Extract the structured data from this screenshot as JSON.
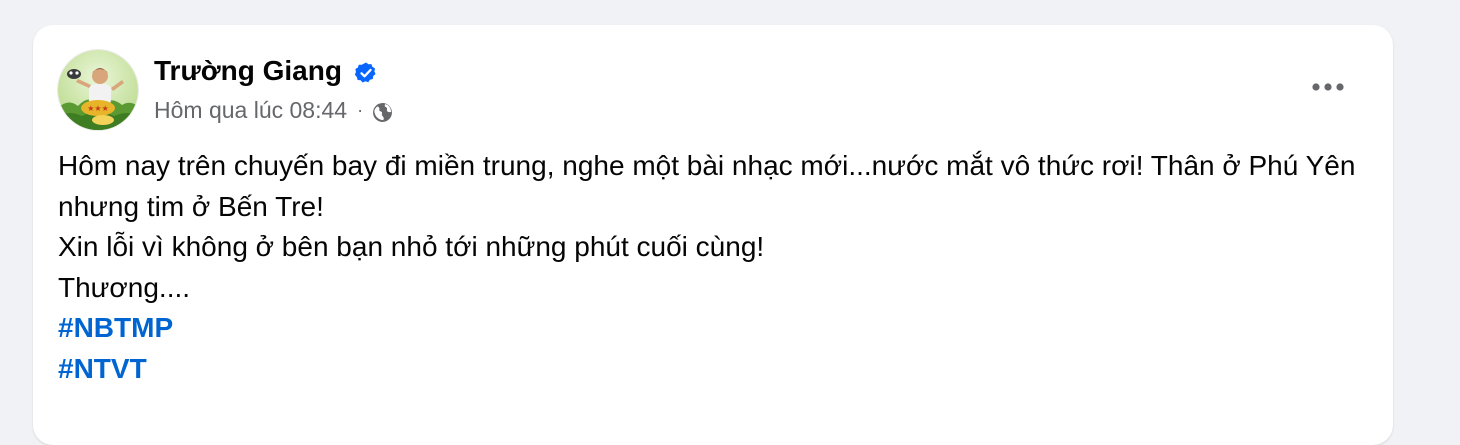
{
  "post": {
    "author": "Trường Giang",
    "timestamp": "Hôm qua lúc 08:44",
    "separator": "·",
    "verified_icon": "verified-badge-icon",
    "privacy_icon": "globe-icon",
    "more_icon": "more-options-icon",
    "text_lines": [
      "Hôm nay trên chuyến bay đi miền trung, nghe một bài nhạc mới...nước mắt vô thức rơi! Thân ở Phú Yên nhưng tim ở Bến Tre!",
      "Xin lỗi vì không ở bên bạn nhỏ tới những phút cuối cùng!",
      "Thương...."
    ],
    "hashtags": [
      "#NBTMP",
      "#NTVT"
    ]
  },
  "colors": {
    "background": "#f0f2f5",
    "card": "#ffffff",
    "hashtag": "#0064d1",
    "verified": "#0866ff",
    "meta": "#65676b"
  }
}
